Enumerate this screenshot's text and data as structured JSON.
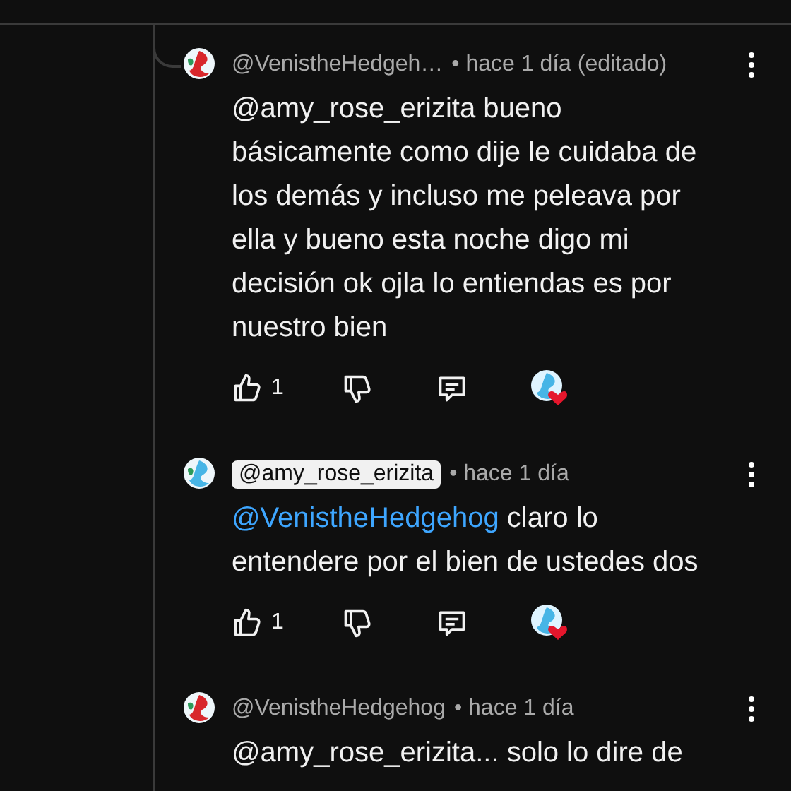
{
  "comments": [
    {
      "author": "@VenistheHedgeh…",
      "author_highlighted": false,
      "time": "• hace 1 día (editado)",
      "text": "@amy_rose_erizita bueno básicamente como dije le cuidaba de los demás y incluso me peleava por ella y bueno esta noche digo mi decisión ok ojla lo entiendas es por nuestro bien",
      "likes": "1",
      "hearted": true,
      "color": "#d8262b"
    },
    {
      "author": "@amy_rose_erizita",
      "author_highlighted": true,
      "time": "• hace 1 día",
      "mention": "@VenistheHedgehog",
      "text": "claro lo entendere por el bien de ustedes dos",
      "likes": "1",
      "hearted": true,
      "color": "#47b5e6"
    },
    {
      "author": "@VenistheHedgehog",
      "author_highlighted": false,
      "time": "• hace 1 día",
      "text": "@amy_rose_erizita... solo lo dire de",
      "color": "#d8262b"
    }
  ]
}
